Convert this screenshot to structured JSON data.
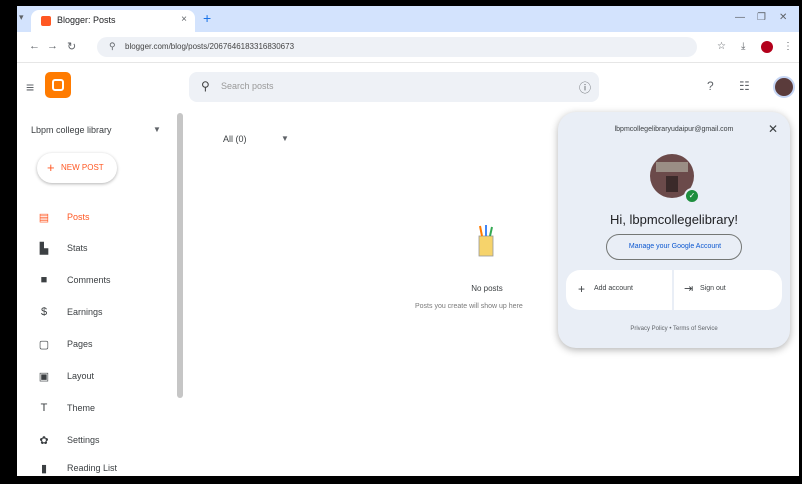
{
  "browser": {
    "tab_title": "Blogger: Posts",
    "tab_close": "×",
    "url": "blogger.com/blog/posts/2067646183316830673",
    "icons": [
      "lock-icon",
      "star-icon",
      "download-icon",
      "more-icon"
    ]
  },
  "app": {
    "search_placeholder": "Search posts",
    "blog_name": "Lbpm college library"
  },
  "sidebar": {
    "new_post": "NEW POST",
    "items": [
      {
        "label": "Posts",
        "icon": "posts-icon"
      },
      {
        "label": "Stats",
        "icon": "stats-icon"
      },
      {
        "label": "Comments",
        "icon": "comments-icon"
      },
      {
        "label": "Earnings",
        "icon": "earnings-icon"
      },
      {
        "label": "Pages",
        "icon": "pages-icon"
      },
      {
        "label": "Layout",
        "icon": "layout-icon"
      },
      {
        "label": "Theme",
        "icon": "theme-icon"
      },
      {
        "label": "Settings",
        "icon": "settings-icon"
      },
      {
        "label": "Reading List",
        "icon": "reading-list-icon"
      }
    ]
  },
  "main": {
    "filter": "All (0)",
    "empty_title": "No posts",
    "empty_sub": "Posts you create will show up here"
  },
  "account": {
    "email": "lbpmcollegelibraryudaipur@gmail.com",
    "greeting": "Hi, lbpmcollegelibrary!",
    "manage": "Manage your Google Account",
    "add_account": "Add account",
    "sign_out": "Sign out",
    "footer": "Privacy Policy  •  Terms of Service"
  },
  "colors": {
    "accent": "#ff5722",
    "tabbar": "#d3e3fd",
    "popup_bg": "#e9eef6"
  }
}
